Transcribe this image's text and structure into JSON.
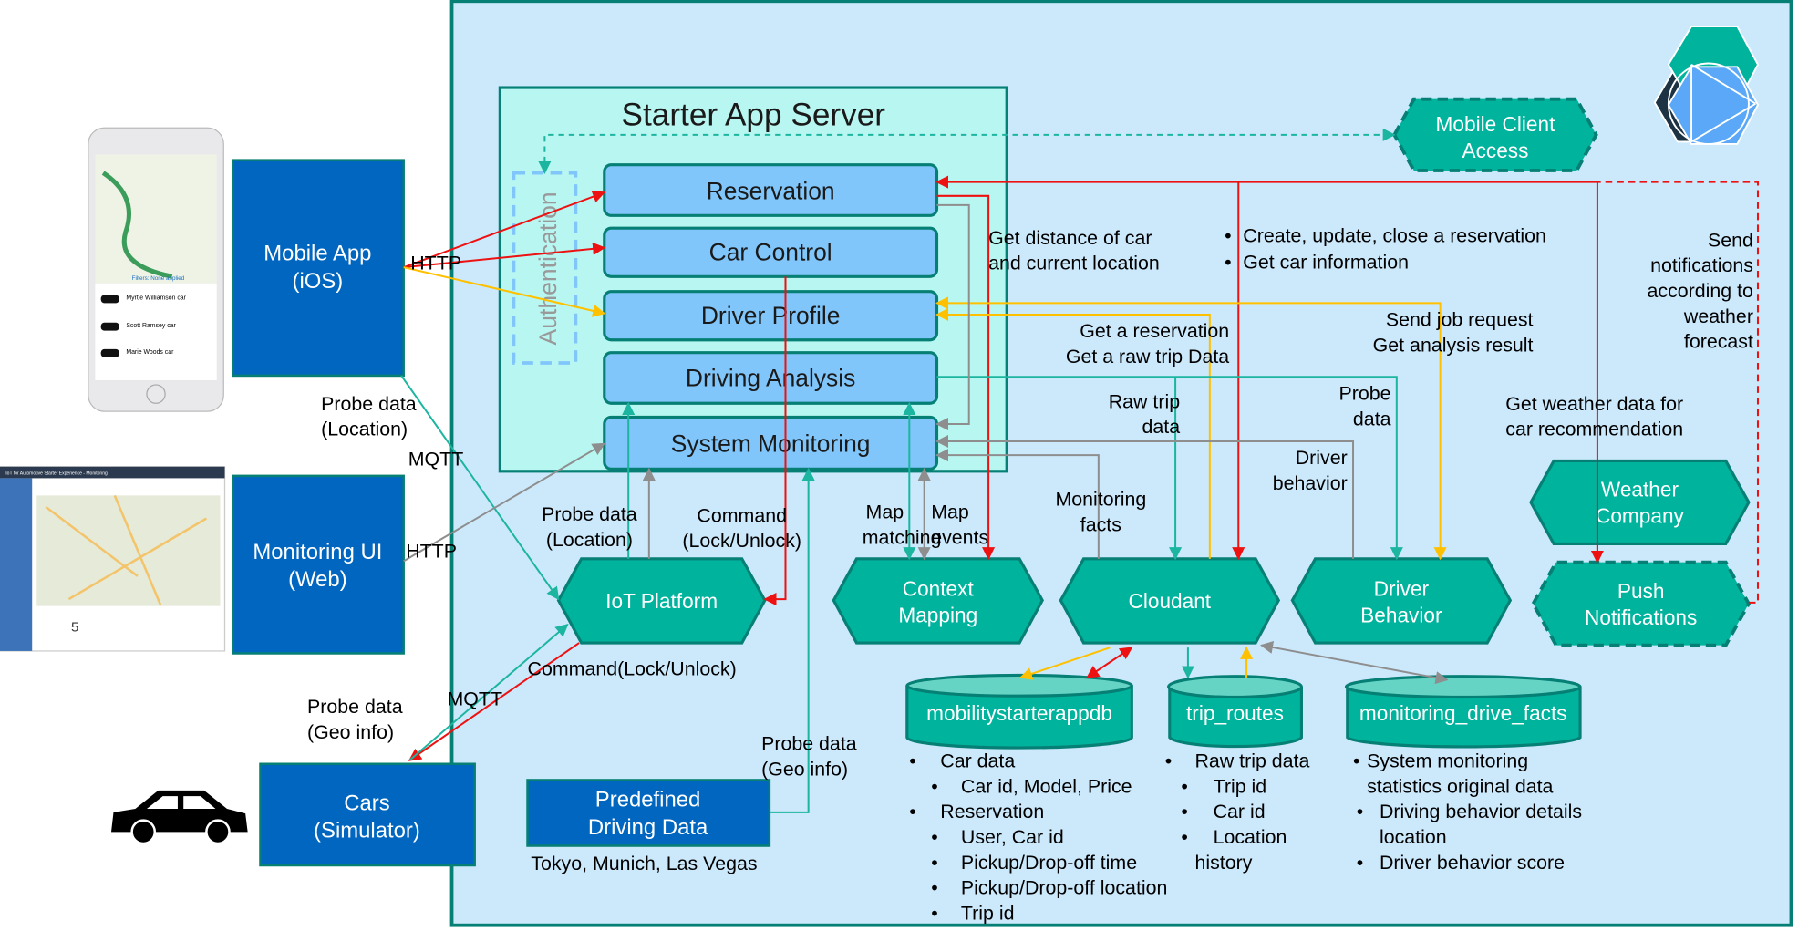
{
  "colors": {
    "background": "#cce9fc",
    "frame": "#067f74",
    "server": "#b8f7f1",
    "service": "#80c6fb",
    "hex": "#00b39d",
    "blue_box": "#0066bf",
    "red": "#ee1111",
    "yellow": "#ffc000",
    "teal": "#1cb5a0",
    "gray": "#8e8e8e"
  },
  "server": {
    "title": "Starter App Server",
    "auth": "Authentication",
    "services": [
      "Reservation",
      "Car Control",
      "Driver Profile",
      "Driving Analysis",
      "System Monitoring"
    ]
  },
  "clients": {
    "mobile": [
      "Mobile App",
      "(iOS)"
    ],
    "monitoring": [
      "Monitoring UI",
      "(Web)"
    ],
    "cars": [
      "Cars",
      "(Simulator)"
    ],
    "predefined": [
      "Predefined",
      "Driving Data"
    ],
    "predefined_caption": "Tokyo, Munich, Las Vegas",
    "phone_list": [
      "Myrtle Williamson car",
      "Scott Ramsey car",
      "Marie Woods car"
    ],
    "phone_filter": "Filters: None applied",
    "web_title": "IoT for Automotive Starter Experience - Monitoring",
    "web_count": "5"
  },
  "services_ext": {
    "iot": "IoT Platform",
    "context": [
      "Context",
      "Mapping"
    ],
    "cloudant": "Cloudant",
    "driver": [
      "Driver",
      "Behavior"
    ],
    "weather": [
      "Weather",
      "Company"
    ],
    "push": [
      "Push",
      "Notifications"
    ],
    "mca": [
      "Mobile Client",
      "Access"
    ]
  },
  "databases": {
    "db1": {
      "name": "mobilitystarterappdb",
      "items": [
        {
          "level": 1,
          "text": "Car data"
        },
        {
          "level": 2,
          "text": "Car id, Model, Price"
        },
        {
          "level": 1,
          "text": "Reservation"
        },
        {
          "level": 2,
          "text": "User, Car id"
        },
        {
          "level": 2,
          "text": "Pickup/Drop-off time"
        },
        {
          "level": 2,
          "text": "Pickup/Drop-off location"
        },
        {
          "level": 2,
          "text": "Trip id"
        }
      ]
    },
    "db2": {
      "name": "trip_routes",
      "items": [
        {
          "level": 1,
          "text": "Raw trip data"
        },
        {
          "level": 2,
          "text": "Trip id"
        },
        {
          "level": 2,
          "text": "Car id"
        },
        {
          "level": 2,
          "text": "Location"
        },
        {
          "level": 0,
          "text": "history"
        }
      ]
    },
    "db3": {
      "name": "monitoring_drive_facts",
      "items": [
        {
          "level": 1,
          "text": "System monitoring"
        },
        {
          "level": 0,
          "text": "statistics original data"
        },
        {
          "level": 2,
          "text": "Driving behavior details"
        },
        {
          "level": 3,
          "text": "location"
        },
        {
          "level": 2,
          "text": "Driver behavior score"
        }
      ]
    }
  },
  "labels": {
    "http1": "HTTP",
    "http2": "HTTP",
    "mqtt1": "MQTT",
    "mqtt2": "MQTT",
    "probe_loc1": [
      "Probe data",
      "(Location)"
    ],
    "probe_loc2": [
      "Probe data",
      "(Location)"
    ],
    "command": [
      "Command",
      "(Lock/Unlock)"
    ],
    "map_matching": [
      "Map",
      "matching"
    ],
    "map_events": [
      "Map",
      "events"
    ],
    "distance": [
      "Get distance of car",
      "and current location"
    ],
    "reservation_ops": [
      "Create, update, close a reservation",
      "Get car information"
    ],
    "get_reservation": [
      "Get a reservation",
      "Get a raw trip Data"
    ],
    "job": [
      "Send job request",
      "Get analysis result"
    ],
    "notify": [
      "Send",
      "notifications",
      "according to",
      "weather",
      "forecast"
    ],
    "raw_trip": [
      "Raw trip",
      "data"
    ],
    "probe": [
      "Probe",
      "data"
    ],
    "monitoring_facts": [
      "Monitoring",
      "facts"
    ],
    "driver_behavior": [
      "Driver",
      "behavior"
    ],
    "weather_data": [
      "Get weather data for",
      "car recommendation"
    ],
    "command_lock": "Command(Lock/Unlock)",
    "probe_geo1": [
      "Probe data",
      "(Geo info)"
    ],
    "probe_geo2": [
      "Probe data",
      "(Geo info)"
    ]
  },
  "logo": "ibm-bluemix-logo"
}
